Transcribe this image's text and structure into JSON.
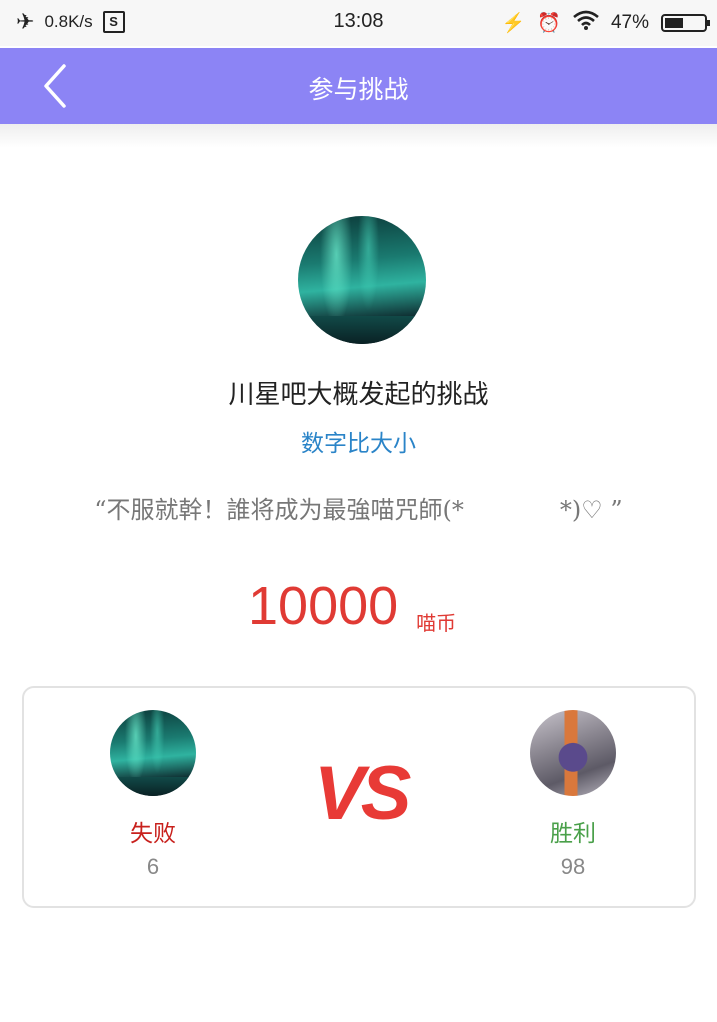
{
  "status_bar": {
    "network_speed": "0.8K/s",
    "sim_icon_label": "S",
    "time": "13:08",
    "battery_percent": "47%",
    "battery_level": 0.47,
    "icons": [
      "airplane-icon",
      "sim-icon",
      "charging-icon",
      "alarm-icon",
      "wifi-icon",
      "battery-icon"
    ]
  },
  "nav": {
    "title": "参与挑战",
    "back_icon": "chevron-left-icon"
  },
  "challenge": {
    "title": "川星吧大概发起的挑战",
    "game_type": "数字比大小",
    "quote": "“不服就幹！誰将成为最強喵咒師(*　　　　*)♡ ”",
    "reward_amount": "10000",
    "reward_unit": "喵币"
  },
  "result": {
    "vs_text": "VS",
    "left": {
      "label": "失败",
      "score": "6"
    },
    "right": {
      "label": "胜利",
      "score": "98"
    }
  },
  "colors": {
    "nav_bg": "#8c84f5",
    "reward_red": "#e03a34",
    "lose_red": "#c8201c",
    "win_green": "#4aa04a",
    "game_type_blue": "#2a84c8"
  }
}
